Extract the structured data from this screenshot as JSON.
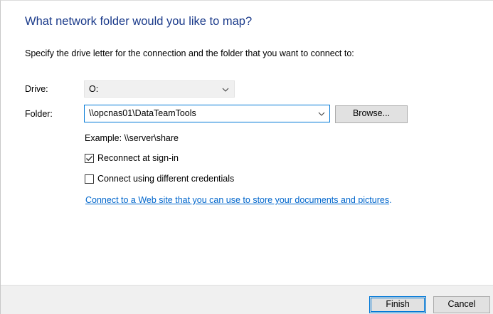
{
  "dialog": {
    "heading": "What network folder would you like to map?",
    "instruction": "Specify the drive letter for the connection and the folder that you want to connect to:"
  },
  "drive": {
    "label": "Drive:",
    "value": "O:",
    "icon": "chevron-down-icon"
  },
  "folder": {
    "label": "Folder:",
    "value": "\\\\opcnas01\\DataTeamTools",
    "icon": "chevron-down-icon",
    "browse_label": "Browse...",
    "example": "Example: \\\\server\\share"
  },
  "options": {
    "reconnect": {
      "label": "Reconnect at sign-in",
      "checked": true,
      "icon": "checkmark-icon"
    },
    "different_credentials": {
      "label": "Connect using different credentials",
      "checked": false
    }
  },
  "web_link": {
    "text": "Connect to a Web site that you can use to store your documents and pictures",
    "trailing": "."
  },
  "footer": {
    "finish_label": "Finish",
    "cancel_label": "Cancel"
  },
  "colors": {
    "heading": "#1a3a8a",
    "accent": "#0078d7",
    "link": "#0066cc",
    "footer_bg": "#f0f0f0"
  }
}
